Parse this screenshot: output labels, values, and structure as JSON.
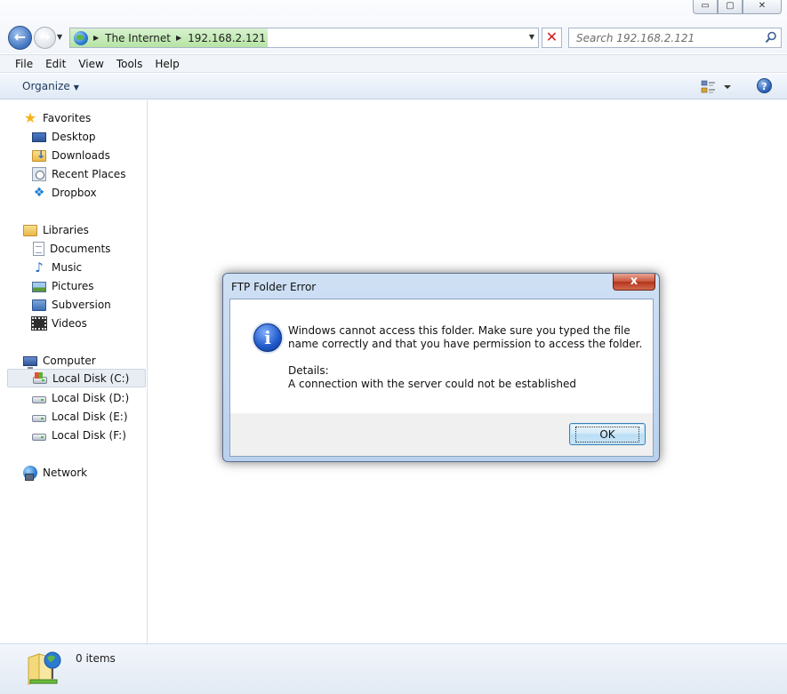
{
  "window": {
    "buttons": {
      "minimize": "▭",
      "maximize": "▢",
      "close": "✕"
    }
  },
  "address": {
    "crumbs": [
      "The Internet",
      "192.168.2.121"
    ]
  },
  "search": {
    "placeholder": "Search 192.168.2.121"
  },
  "menu": [
    "File",
    "Edit",
    "View",
    "Tools",
    "Help"
  ],
  "toolbar": {
    "organize": "Organize",
    "help": "?"
  },
  "sidebar": {
    "favorites": {
      "label": "Favorites",
      "items": [
        "Desktop",
        "Downloads",
        "Recent Places",
        "Dropbox"
      ]
    },
    "libraries": {
      "label": "Libraries",
      "items": [
        "Documents",
        "Music",
        "Pictures",
        "Subversion",
        "Videos"
      ]
    },
    "computer": {
      "label": "Computer",
      "items": [
        "Local Disk (C:)",
        "Local Disk (D:)",
        "Local Disk (E:)",
        "Local Disk (F:)"
      ],
      "selected": "Local Disk (C:)"
    },
    "network": {
      "label": "Network"
    }
  },
  "status": {
    "items": "0 items"
  },
  "dialog": {
    "title": "FTP Folder Error",
    "close": "x",
    "icon": "info-icon",
    "message": "Windows cannot access this folder. Make sure you typed the file name correctly and that you have permission to access the folder.",
    "details_label": "Details:",
    "details_text": "A connection with the server could not be established",
    "ok": "OK"
  },
  "colors": {
    "dialog_frame": "#b9d1ee",
    "close_red": "#c8553d",
    "address_green": "#b6e4a4"
  }
}
